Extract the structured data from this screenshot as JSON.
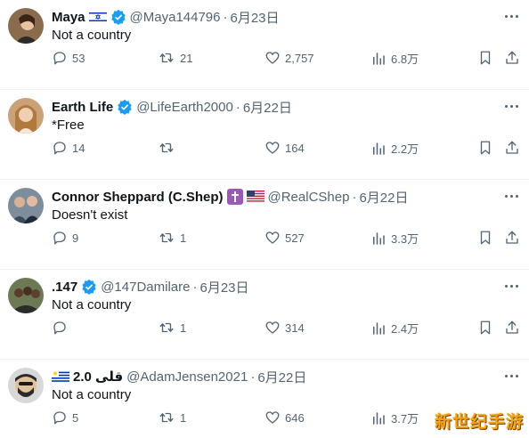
{
  "tweets": [
    {
      "name": "Maya",
      "name_flags": "israel-flag",
      "verified": true,
      "handle": "@Maya144796",
      "separator": "·",
      "date": "6月23日",
      "text": "Not a country",
      "replies": "53",
      "retweets": "21",
      "likes": "2,757",
      "views": "6.8万",
      "avatar_color": "#8b6b4e"
    },
    {
      "name": "Earth Life",
      "name_flags": "",
      "verified": true,
      "handle": "@LifeEarth2000",
      "separator": "·",
      "date": "6月22日",
      "text": "*Free",
      "replies": "14",
      "retweets": "",
      "likes": "164",
      "views": "2.2万",
      "avatar_color": "#c9a27a"
    },
    {
      "name": "Connor Sheppard (C.Shep)",
      "name_flags": "cross-emoji us-flag",
      "verified": false,
      "handle": "@RealCShep",
      "separator": "·",
      "date": "6月22日",
      "text": "Doesn't exist",
      "replies": "9",
      "retweets": "1",
      "likes": "527",
      "views": "3.3万",
      "avatar_color": "#5a6b7a"
    },
    {
      "name": ".147",
      "name_flags": "",
      "verified": true,
      "handle": "@147Damilare",
      "separator": "·",
      "date": "6月23日",
      "text": "Not a country",
      "replies": "",
      "retweets": "1",
      "likes": "314",
      "views": "2.4万",
      "avatar_color": "#6b7a55"
    },
    {
      "name": "قلى 2.0",
      "name_flags": "uruguay-flag",
      "verified": false,
      "handle": "@AdamJensen2021",
      "separator": "·",
      "date": "6月22日",
      "text": "Not a country",
      "replies": "5",
      "retweets": "1",
      "likes": "646",
      "views": "3.7万",
      "avatar_color": "#3b3b3b"
    }
  ],
  "watermark": "新世纪手游",
  "colors": {
    "verified": "#1d9bf0",
    "secondary_text": "#536471",
    "primary_text": "#0f1419"
  }
}
